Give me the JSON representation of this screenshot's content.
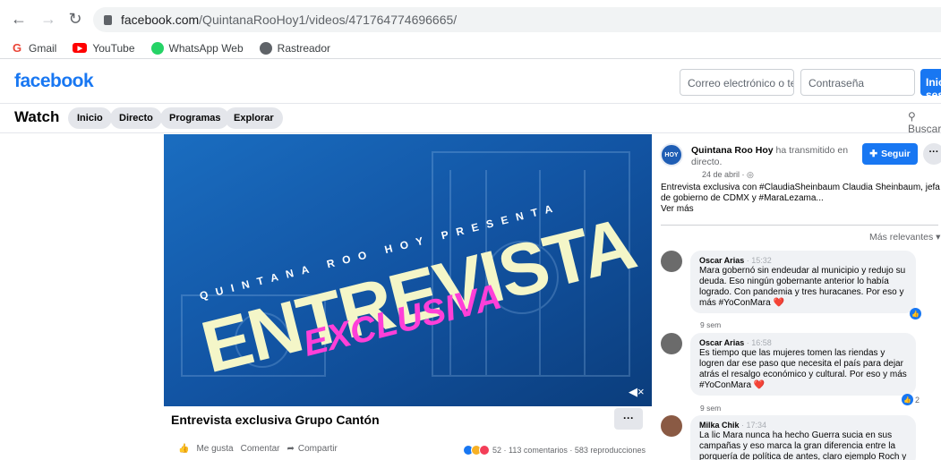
{
  "browser": {
    "url_host": "facebook.com",
    "url_path": "/QuintanaRooHoy1/videos/471764774696665/",
    "bookmarks": [
      {
        "label": "Gmail",
        "icon": "gmail-icon",
        "color": "#ea4335"
      },
      {
        "label": "YouTube",
        "icon": "youtube-icon",
        "color": "#ff0000"
      },
      {
        "label": "WhatsApp Web",
        "icon": "whatsapp-icon",
        "color": "#25d366"
      },
      {
        "label": "Rastreador",
        "icon": "globe-icon",
        "color": "#5f6368"
      }
    ]
  },
  "fb": {
    "logo": "facebook",
    "email_placeholder": "Correo electrónico o teléfono",
    "password_placeholder": "Contraseña",
    "login_label": "Iniciar sesión",
    "brand_color": "#1877f2"
  },
  "watch": {
    "title": "Watch",
    "tabs": [
      "Inicio",
      "Directo",
      "Programas",
      "Explorar"
    ],
    "search_label": "Buscar"
  },
  "video": {
    "overlay_small": "QUINTANA ROO HOY PRESENTA",
    "overlay_big": "ENTREVISTA",
    "overlay_accent": "EXCLUSIVA",
    "title": "Entrevista exclusiva Grupo Cantón",
    "more_label": "···",
    "like_label": "Me gusta",
    "comment_label": "Comentar",
    "share_label": "Compartir",
    "reactions_count": "52",
    "stats": "· 113 comentarios · 583 reproducciones"
  },
  "post": {
    "page_name": "Quintana Roo Hoy",
    "action_text": " ha transmitido en directo.",
    "date": "24 de abril · ",
    "avatar_text": "HOY",
    "follow_label": "Seguir",
    "text": "Entrevista exclusiva con #ClaudiaSheinbaum Claudia Sheinbaum, jefa de gobierno de CDMX y #MaraLezama...",
    "see_more": "Ver más",
    "sort_label": "Más relevantes ▾"
  },
  "comments": [
    {
      "name": "Oscar Arias",
      "time": "· 15:32",
      "text": "Mara gobernó sin endeudar al municipio y redujo su deuda. Eso ningún gobernante anterior lo había logrado. Con pandemia y tres huracanes. Por eso y más #YoConMara ❤️",
      "age": "9 sem",
      "likes": ""
    },
    {
      "name": "Oscar Arias",
      "time": "· 16:58",
      "text": "Es tiempo que las mujeres tomen las riendas y logren dar ese paso que necesita el país para dejar atrás el resalgo económico y cultural. Por eso y más #YoConMara ❤️",
      "age": "9 sem",
      "likes": "2"
    },
    {
      "name": "Milka Chik",
      "time": "· 17:34",
      "text": "La lic Mara nunca ha hecho Guerra sucia en sus campañas y eso marca la gran diferencia entre la porquería de política de antes, claro ejemplo Roch y",
      "age": "",
      "likes": ""
    }
  ]
}
